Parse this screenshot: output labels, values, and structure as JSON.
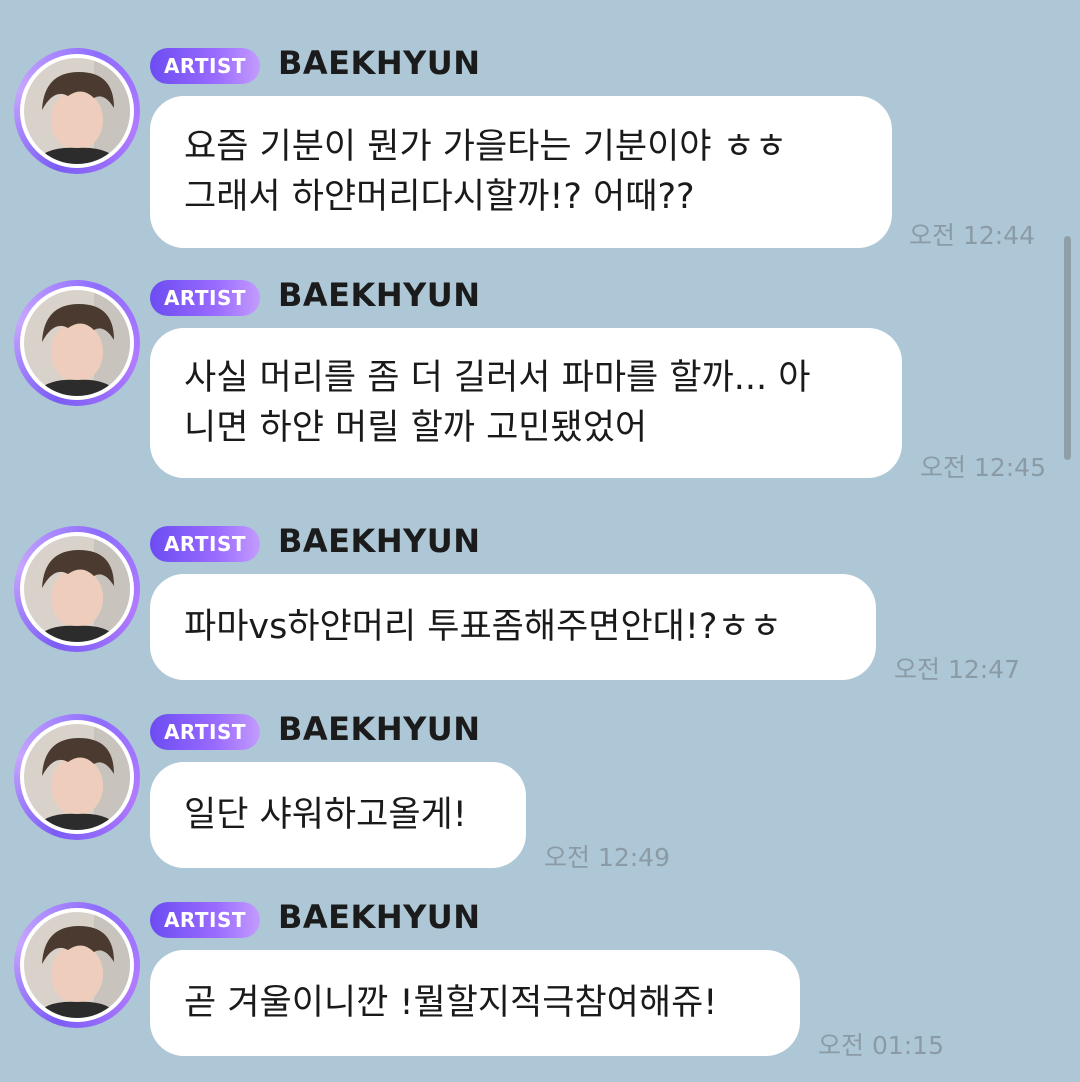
{
  "messages": [
    {
      "badge": "ARTIST",
      "sender": "BAEKHYUN",
      "text": "요즘 기분이 뭔가 가을타는 기분이야 ㅎㅎ\n그래서 하얀머리다시할까!? 어때??",
      "time": "오전 12:44"
    },
    {
      "badge": "ARTIST",
      "sender": "BAEKHYUN",
      "text": "사실 머리를 좀 더 길러서 파마를 할까... 아\n니면 하얀 머릴 할까 고민됐었어",
      "time": "오전 12:45"
    },
    {
      "badge": "ARTIST",
      "sender": "BAEKHYUN",
      "text": "파마vs하얀머리 투표좀해주면안대!?ㅎㅎ",
      "time": "오전 12:47"
    },
    {
      "badge": "ARTIST",
      "sender": "BAEKHYUN",
      "text": "일단 샤워하고올게!",
      "time": "오전 12:49"
    },
    {
      "badge": "ARTIST",
      "sender": "BAEKHYUN",
      "text": "곧 겨울이니깐 !뭘할지적극참여해쥬!",
      "time": "오전 01:15"
    }
  ],
  "colors": {
    "background": "#adc7d6",
    "bubble": "#ffffff",
    "badge_start": "#6c4cf2",
    "badge_end": "#c39bff",
    "timestamp": "#8b9ba6"
  },
  "icons": {
    "avatar": "profile-photo",
    "scrollbar": "scrollbar-thumb"
  }
}
